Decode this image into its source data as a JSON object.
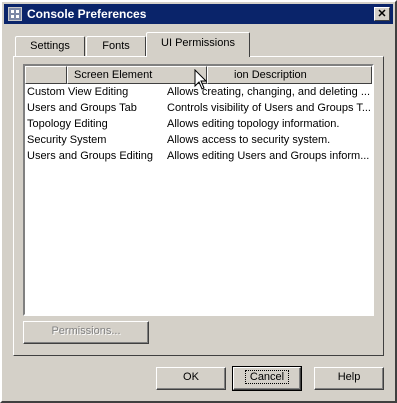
{
  "window": {
    "title": "Console Preferences",
    "close_glyph": "✕"
  },
  "tabs": [
    {
      "label": "Settings"
    },
    {
      "label": "Fonts"
    },
    {
      "label": "UI Permissions"
    }
  ],
  "list": {
    "columns": [
      "Screen Element",
      "ion Description"
    ],
    "rows": [
      {
        "element": "Custom View Editing",
        "description": "Allows creating, changing, and deleting ..."
      },
      {
        "element": "Users and Groups Tab",
        "description": "Controls visibility of Users and Groups T..."
      },
      {
        "element": "Topology Editing",
        "description": "Allows editing topology information."
      },
      {
        "element": "Security System",
        "description": "Allows access to security system."
      },
      {
        "element": "Users and Groups Editing",
        "description": "Allows editing Users and Groups inform..."
      }
    ]
  },
  "buttons": {
    "permissions": "Permissions...",
    "ok": "OK",
    "cancel": "Cancel",
    "help": "Help"
  },
  "icons": {
    "app": "app-grid-icon",
    "cursor": "arrow-cursor-icon"
  }
}
